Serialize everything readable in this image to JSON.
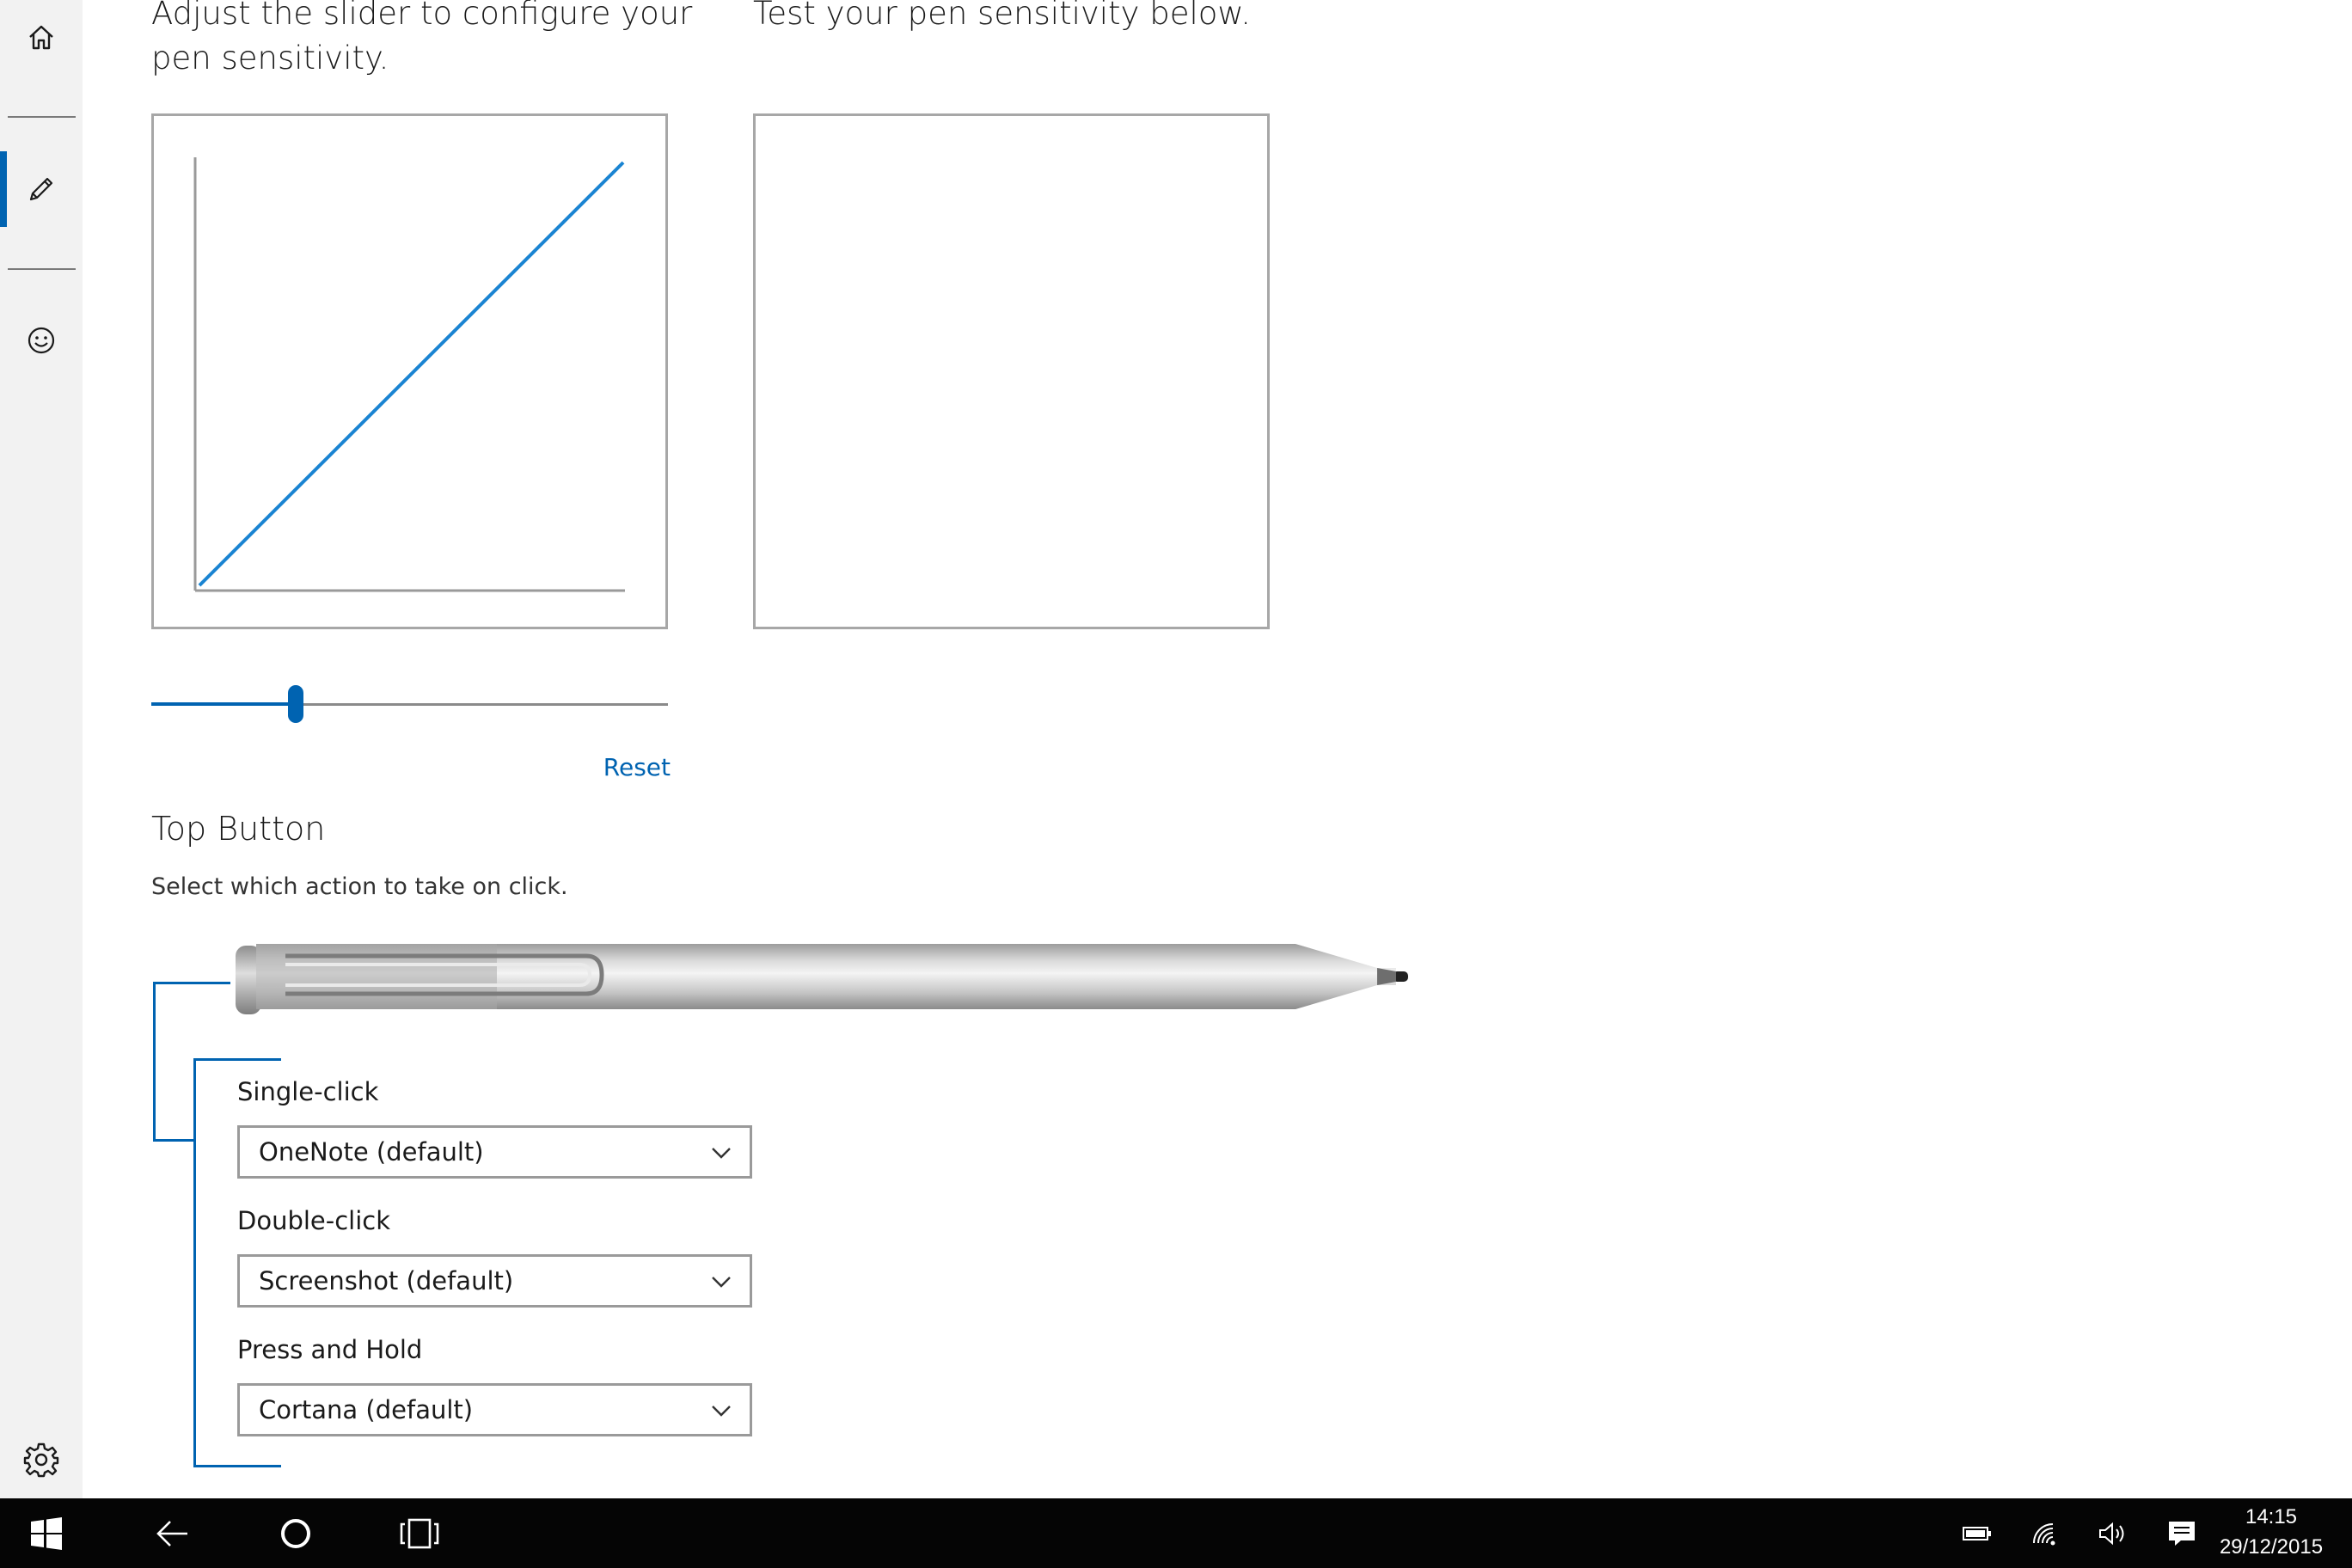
{
  "nav": {
    "items": [
      {
        "name": "home",
        "icon": "home-icon",
        "selected": false
      },
      {
        "name": "pen",
        "icon": "pen-icon",
        "selected": true
      },
      {
        "name": "feedback",
        "icon": "smiley-icon",
        "selected": false
      }
    ],
    "settings_icon": "gear-icon"
  },
  "sensitivity": {
    "heading": "Adjust the slider to configure your pen sensitivity.",
    "test_heading": "Test your pen sensitivity below.",
    "slider_value": 0.28,
    "reset_label": "Reset"
  },
  "top_button": {
    "title": "Top Button",
    "description": "Select which action to take on click.",
    "single_click": {
      "label": "Single-click",
      "value": "OneNote (default)"
    },
    "double_click": {
      "label": "Double-click",
      "value": "Screenshot (default)"
    },
    "press_hold": {
      "label": "Press and Hold",
      "value": "Cortana (default)"
    }
  },
  "taskbar": {
    "start_icon": "windows-logo-icon",
    "back_icon": "back-arrow-icon",
    "cortana_icon": "cortana-circle-icon",
    "task_view_icon": "task-view-icon",
    "tray": [
      "battery-icon",
      "wifi-icon",
      "volume-icon",
      "action-center-icon"
    ],
    "time": "14:15",
    "date": "29/12/2015"
  },
  "colors": {
    "accent": "#0063b1",
    "curve": "#1a84d2",
    "taskbar": "#050505",
    "rail": "#f2f2f2"
  }
}
